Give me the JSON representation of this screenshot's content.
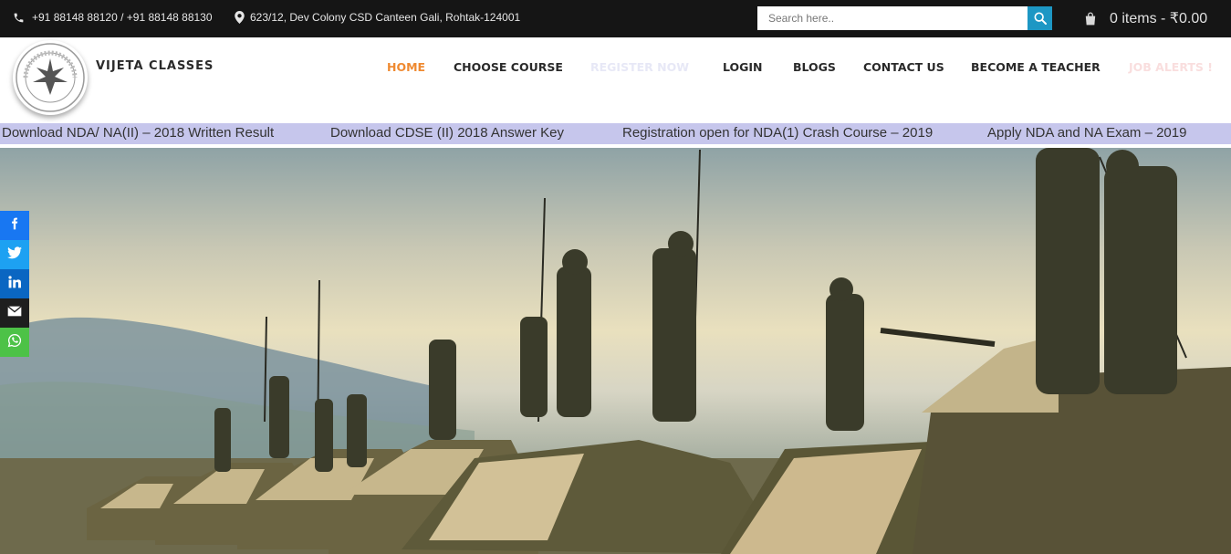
{
  "topbar": {
    "phone": "+91 88148 88120 / +91 88148 88130",
    "address": "623/12, Dev Colony CSD Canteen Gali, Rohtak-124001",
    "search_placeholder": "Search here..",
    "cart_text": "0 items - ₹0.00"
  },
  "header": {
    "brand": "VIJETA CLASSES",
    "logo_text": "VIJETA CLASSES",
    "nav": [
      {
        "label": "HOME"
      },
      {
        "label": "CHOOSE COURSE"
      },
      {
        "label": "REGISTER NOW"
      },
      {
        "label": "LOGIN"
      },
      {
        "label": "BLOGS"
      },
      {
        "label": "CONTACT US"
      },
      {
        "label": "BECOME A TEACHER"
      },
      {
        "label": "JOB ALERTS !"
      }
    ]
  },
  "ticker": [
    "Download NDA/ NA(II) – 2018 Written Result",
    "Download CDSE (II) 2018 Answer Key",
    "Registration open for NDA(1) Crash Course – 2019",
    "Apply NDA and NA Exam – 2019"
  ],
  "share": [
    {
      "icon": "facebook-icon",
      "color": "#1877f2"
    },
    {
      "icon": "twitter-icon",
      "color": "#1da1f2"
    },
    {
      "icon": "linkedin-icon",
      "color": "#0a66c2"
    },
    {
      "icon": "email-icon",
      "color": "#1e1e1e"
    },
    {
      "icon": "whatsapp-icon",
      "color": "#4dc247"
    }
  ],
  "colors": {
    "topbar_bg": "#151515",
    "accent_orange": "#ef8a31",
    "ticker_bg": "#c6c6ec",
    "search_button": "#1d97c4"
  }
}
